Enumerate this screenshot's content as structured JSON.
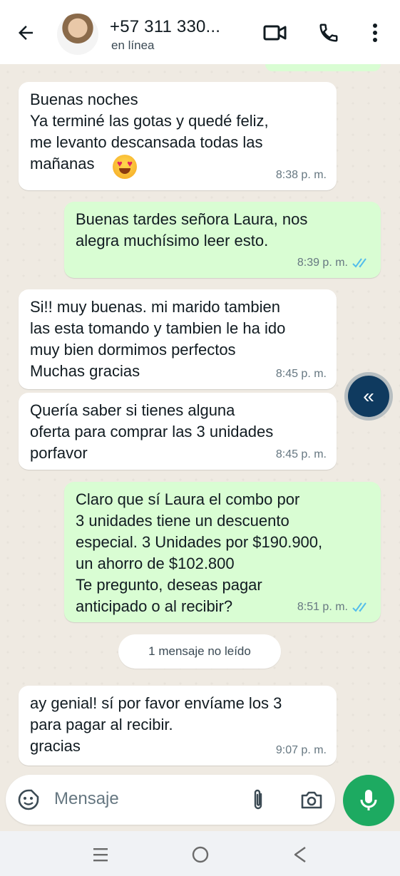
{
  "header": {
    "back_icon": "arrow-left-icon",
    "contact_name": "+57 311 330...",
    "status": "en línea",
    "video_icon": "video-camera-icon",
    "call_icon": "phone-icon",
    "menu_icon": "more-vertical-icon"
  },
  "messages": [
    {
      "direction": "in",
      "text": "Buenas noches\nYa terminé las gotas y quedé feliz,\nme levanto descansada todas las\nmañanas",
      "emoji": "heart-eyes-emoji",
      "time": "8:38 p. m."
    },
    {
      "direction": "out",
      "text": "Buenas tardes señora Laura, nos\nalegra muchísimo leer esto.",
      "time": "8:39 p. m.",
      "status": "read"
    },
    {
      "direction": "in",
      "text": "Si!! muy buenas. mi marido tambien\nlas esta tomando y tambien le ha ido\nmuy bien dormimos perfectos\nMuchas gracias",
      "time": "8:45 p. m."
    },
    {
      "direction": "in",
      "text": "Quería saber si tienes alguna\noferta para comprar las 3 unidades\nporfavor",
      "time": "8:45 p. m."
    },
    {
      "direction": "out",
      "text": "Claro que sí Laura el combo por\n3 unidades tiene un descuento\nespecial. 3 Unidades por $190.900,\nun ahorro de $102.800\nTe pregunto, deseas pagar\nanticipado o al recibir?",
      "time": "8:51 p. m.",
      "status": "read"
    },
    {
      "direction": "in",
      "text": "ay genial! sí por favor envíame los 3\npara pagar al recibir.\ngracias",
      "time": "9:07 p. m."
    }
  ],
  "unread_label": "1 mensaje no leído",
  "scroll_button_icon": "double-chevron-left-icon",
  "input": {
    "placeholder": "Mensaje",
    "emoji_icon": "sticker-emoji-icon",
    "attach_icon": "paperclip-icon",
    "camera_icon": "camera-icon",
    "mic_icon": "microphone-icon"
  },
  "navbar": {
    "recent_icon": "recent-apps-icon",
    "home_icon": "home-circle-icon",
    "back_icon": "back-triangle-icon"
  },
  "colors": {
    "incoming_bubble": "#ffffff",
    "outgoing_bubble": "#d9fdd3",
    "chat_background": "#efeae2",
    "mic_button": "#1daa61",
    "read_ticks": "#53bdeb"
  }
}
